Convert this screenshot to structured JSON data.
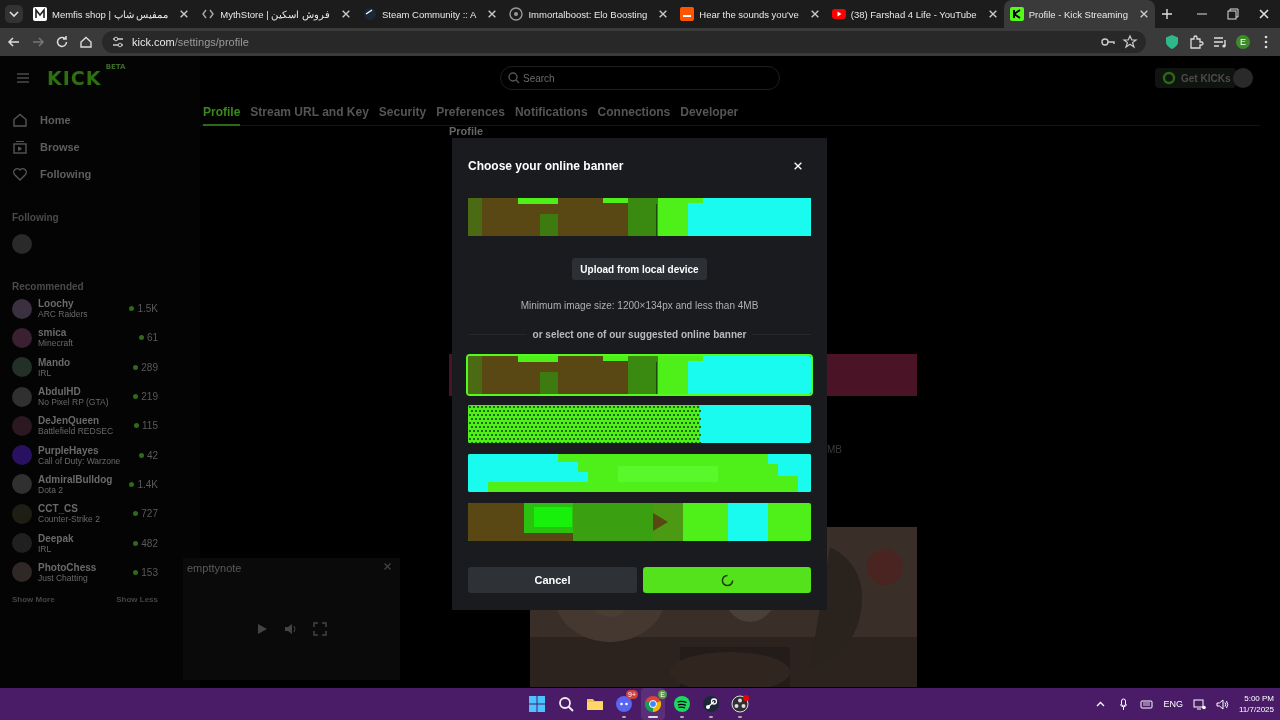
{
  "browser": {
    "tabs": [
      {
        "title": "Memfis shop | ممفیس شاپ",
        "selected": false
      },
      {
        "title": "MythStore | فروش اسکین",
        "selected": false
      },
      {
        "title": "Steam Community :: A",
        "selected": false
      },
      {
        "title": "Immortalboost: Elo Boosting",
        "selected": false
      },
      {
        "title": "Hear the sounds you've",
        "selected": false
      },
      {
        "title": "(38) Farshad 4 Life - YouTube",
        "selected": false
      },
      {
        "title": "Profile - Kick Streaming",
        "selected": true
      }
    ],
    "address": {
      "domain": "kick.com",
      "path": "/settings/profile"
    },
    "profile_letter": "E"
  },
  "sidebar": {
    "logo": "KICK",
    "logo_badge": "BETA",
    "nav": [
      {
        "label": "Home"
      },
      {
        "label": "Browse"
      },
      {
        "label": "Following"
      }
    ],
    "following_heading": "Following",
    "recommended_heading": "Recommended",
    "channels": [
      {
        "name": "Loochy",
        "category": "ARC Raiders",
        "viewers": "1.5K"
      },
      {
        "name": "smica",
        "category": "Minecraft",
        "viewers": "61"
      },
      {
        "name": "Mando",
        "category": "IRL",
        "viewers": "289"
      },
      {
        "name": "AbdulHD",
        "category": "No Pixel RP (GTA)",
        "viewers": "219"
      },
      {
        "name": "DeJenQueen",
        "category": "Battlefield REDSEC",
        "viewers": "115"
      },
      {
        "name": "PurpleHayes",
        "category": "Call of Duty: Warzone",
        "viewers": "42"
      },
      {
        "name": "AdmiralBulldog",
        "category": "Dota 2",
        "viewers": "1.4K"
      },
      {
        "name": "CCT_CS",
        "category": "Counter-Strike 2",
        "viewers": "727"
      },
      {
        "name": "Deepak",
        "category": "IRL",
        "viewers": "482"
      },
      {
        "name": "PhotoChess",
        "category": "Just Chatting",
        "viewers": "153"
      }
    ],
    "show_more": "Show More",
    "show_less": "Show Less"
  },
  "topbar": {
    "search": {
      "placeholder": "Search"
    },
    "get_kicks": "Get KICKs"
  },
  "settings_tabs": [
    {
      "label": "Profile",
      "selected": true
    },
    {
      "label": "Stream URL and Key",
      "selected": false
    },
    {
      "label": "Security",
      "selected": false
    },
    {
      "label": "Preferences",
      "selected": false
    },
    {
      "label": "Notifications",
      "selected": false
    },
    {
      "label": "Connections",
      "selected": false
    },
    {
      "label": "Developer",
      "selected": false
    }
  ],
  "content": {
    "heading": "Profile",
    "size_note": "MB"
  },
  "mini_player": {
    "title": "empttynote"
  },
  "modal": {
    "title": "Choose your online banner",
    "upload_button": "Upload from local device",
    "size_hint": "Minimum image size: 1200×134px and less than 4MB",
    "divider_label": "or select one of our suggested online banner",
    "options": [
      {
        "selected": true
      },
      {
        "selected": false
      },
      {
        "selected": false
      },
      {
        "selected": false
      }
    ],
    "cancel": "Cancel",
    "confirm": {
      "loading": true
    }
  },
  "taskbar": {
    "apps": [
      {
        "running": false,
        "active": false
      },
      {
        "running": false,
        "active": false
      },
      {
        "running": false,
        "active": false
      },
      {
        "running": true,
        "active": false,
        "badge": "9+"
      },
      {
        "running": true,
        "active": true,
        "badge": "E"
      },
      {
        "running": true,
        "active": false
      },
      {
        "running": true,
        "active": false
      },
      {
        "running": true,
        "active": false
      }
    ],
    "language": "ENG",
    "time": "5:00 PM",
    "date": "11/7/2025"
  }
}
